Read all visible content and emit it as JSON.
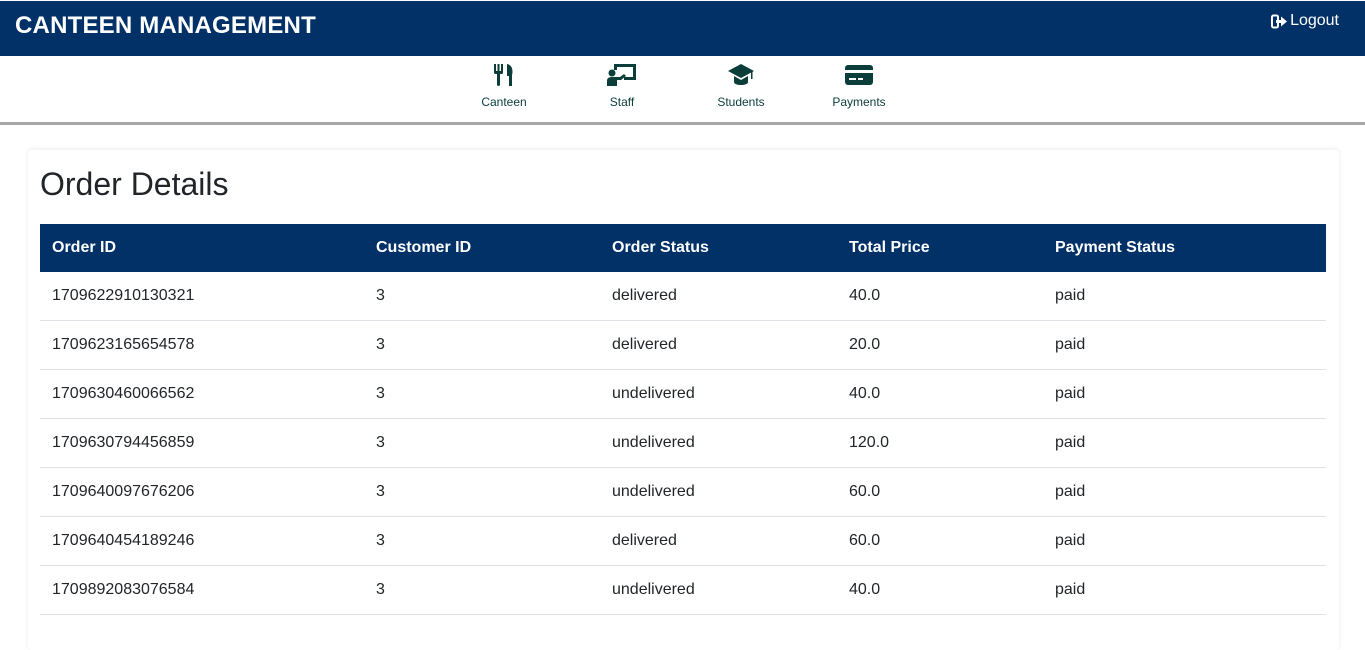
{
  "app": {
    "title": "CANTEEN MANAGEMENT",
    "logout_label": "Logout"
  },
  "nav": {
    "items": [
      {
        "label": "Canteen",
        "icon": "utensils-icon"
      },
      {
        "label": "Staff",
        "icon": "staff-presentation-icon"
      },
      {
        "label": "Students",
        "icon": "graduation-cap-icon"
      },
      {
        "label": "Payments",
        "icon": "credit-card-icon"
      }
    ]
  },
  "page": {
    "title": "Order Details"
  },
  "orders": {
    "columns": [
      "Order ID",
      "Customer ID",
      "Order Status",
      "Total Price",
      "Payment Status"
    ],
    "rows": [
      [
        "1709622910130321",
        "3",
        "delivered",
        "40.0",
        "paid"
      ],
      [
        "1709623165654578",
        "3",
        "delivered",
        "20.0",
        "paid"
      ],
      [
        "1709630460066562",
        "3",
        "undelivered",
        "40.0",
        "paid"
      ],
      [
        "1709630794456859",
        "3",
        "undelivered",
        "120.0",
        "paid"
      ],
      [
        "1709640097676206",
        "3",
        "undelivered",
        "60.0",
        "paid"
      ],
      [
        "1709640454189246",
        "3",
        "delivered",
        "60.0",
        "paid"
      ],
      [
        "1709892083076584",
        "3",
        "undelivered",
        "40.0",
        "paid"
      ]
    ]
  },
  "colors": {
    "primary": "#023168",
    "icon": "#0b3d3a"
  }
}
